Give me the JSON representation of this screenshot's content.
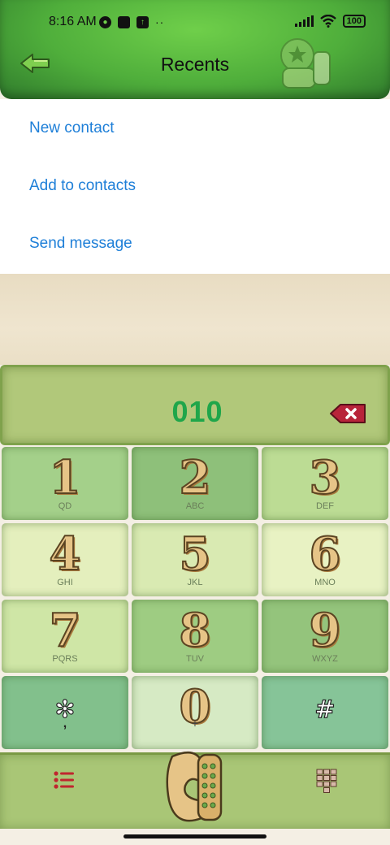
{
  "status_bar": {
    "time": "8:16 AM",
    "battery": "100",
    "more": "··"
  },
  "header": {
    "title": "Recents"
  },
  "menu": {
    "items": [
      {
        "label": "New contact"
      },
      {
        "label": "Add to contacts"
      },
      {
        "label": "Send message"
      }
    ]
  },
  "dialer": {
    "number": "010",
    "keys": [
      {
        "digit": "1",
        "letters": "QD"
      },
      {
        "digit": "2",
        "letters": "ABC"
      },
      {
        "digit": "3",
        "letters": "DEF"
      },
      {
        "digit": "4",
        "letters": "GHI"
      },
      {
        "digit": "5",
        "letters": "JKL"
      },
      {
        "digit": "6",
        "letters": "MNO"
      },
      {
        "digit": "7",
        "letters": "PQRS"
      },
      {
        "digit": "8",
        "letters": "TUV"
      },
      {
        "digit": "9",
        "letters": "WXYZ"
      },
      {
        "digit": "✻",
        "letters": ","
      },
      {
        "digit": "0",
        "letters": "+"
      },
      {
        "digit": "#",
        "letters": ""
      }
    ]
  },
  "colors": {
    "header_green": "#4fae3b",
    "menu_text": "#1e7fd8",
    "number_text": "#1fa64a",
    "key_dark": "#92c27a",
    "key_light": "#e4efbd"
  }
}
